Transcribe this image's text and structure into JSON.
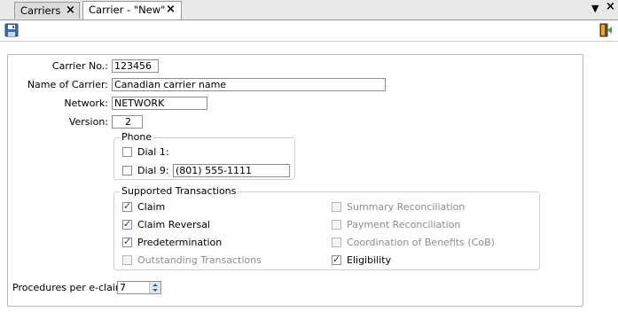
{
  "tabs": [
    {
      "label": "Carriers",
      "active": false
    },
    {
      "label": "Carrier - \"New\"",
      "active": true
    }
  ],
  "tab_controls": {
    "menu_icon": "triangle-down-icon",
    "close_icon": "close-icon"
  },
  "toolbar": {
    "save_icon": "floppy-disk-icon",
    "exit_icon": "exit-door-icon"
  },
  "form": {
    "carrier_no": {
      "label": "Carrier No.:",
      "value": "123456"
    },
    "name_of_carrier": {
      "label": "Name of Carrier:",
      "value": "Canadian carrier name"
    },
    "network": {
      "label": "Network:",
      "value": "NETWORK"
    },
    "version": {
      "label": "Version:",
      "value": "2"
    },
    "phone": {
      "title": "Phone",
      "dial1": {
        "label": "Dial 1:",
        "checked": false
      },
      "dial9": {
        "label": "Dial 9:",
        "checked": false,
        "value": "(801) 555-1111"
      }
    },
    "supported": {
      "title": "Supported Transactions",
      "left": [
        {
          "label": "Claim",
          "checked": true,
          "enabled": true
        },
        {
          "label": "Claim Reversal",
          "checked": true,
          "enabled": true
        },
        {
          "label": "Predetermination",
          "checked": true,
          "enabled": true
        },
        {
          "label": "Outstanding Transactions",
          "checked": false,
          "enabled": false
        }
      ],
      "right": [
        {
          "label": "Summary Reconciliation",
          "checked": false,
          "enabled": false
        },
        {
          "label": "Payment Reconciliation",
          "checked": false,
          "enabled": false
        },
        {
          "label": "Coordination of Benefits (CoB)",
          "checked": false,
          "enabled": false
        },
        {
          "label": "Eligibility",
          "checked": true,
          "enabled": true
        }
      ]
    },
    "procedures": {
      "label": "Procedures per e-claim:",
      "value": "7"
    }
  },
  "colors": {
    "check": "#1a3b7a",
    "disabled_text": "#8d8d8d",
    "tab_active": "#ffffff"
  }
}
